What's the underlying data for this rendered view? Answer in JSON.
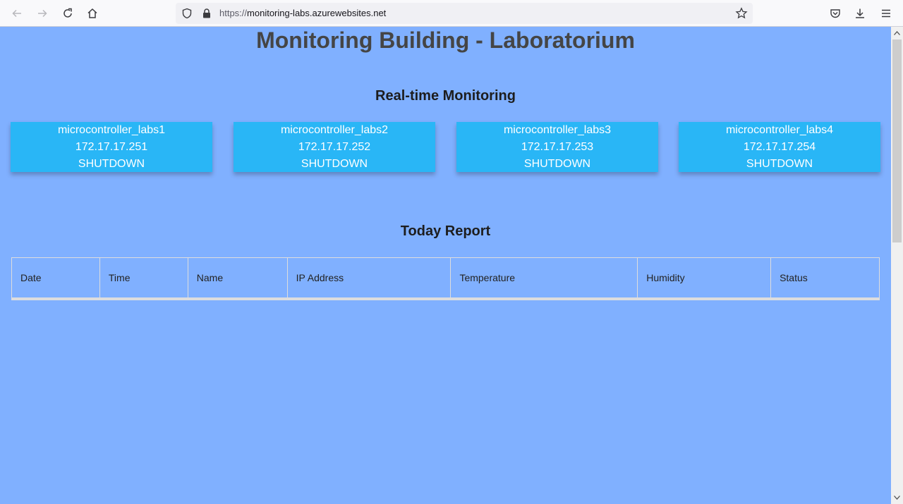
{
  "browser": {
    "url_scheme": "https://",
    "url_host": "monitoring-labs.azurewebsites.net"
  },
  "page": {
    "title": "Monitoring Building - Laboratorium",
    "realtime_heading": "Real-time Monitoring",
    "report_heading": "Today Report"
  },
  "devices": [
    {
      "name": "microcontroller_labs1",
      "ip": "172.17.17.251",
      "status": "SHUTDOWN"
    },
    {
      "name": "microcontroller_labs2",
      "ip": "172.17.17.252",
      "status": "SHUTDOWN"
    },
    {
      "name": "microcontroller_labs3",
      "ip": "172.17.17.253",
      "status": "SHUTDOWN"
    },
    {
      "name": "microcontroller_labs4",
      "ip": "172.17.17.254",
      "status": "SHUTDOWN"
    }
  ],
  "report": {
    "columns": [
      "Date",
      "Time",
      "Name",
      "IP Address",
      "Temperature",
      "Humidity",
      "Status"
    ]
  },
  "colors": {
    "page_background": "#80b0ff",
    "card_background": "#29b6f6"
  },
  "icons": [
    "back-icon",
    "forward-icon",
    "reload-icon",
    "home-icon",
    "shield-icon",
    "lock-icon",
    "star-icon",
    "pocket-icon",
    "download-icon",
    "menu-icon"
  ]
}
